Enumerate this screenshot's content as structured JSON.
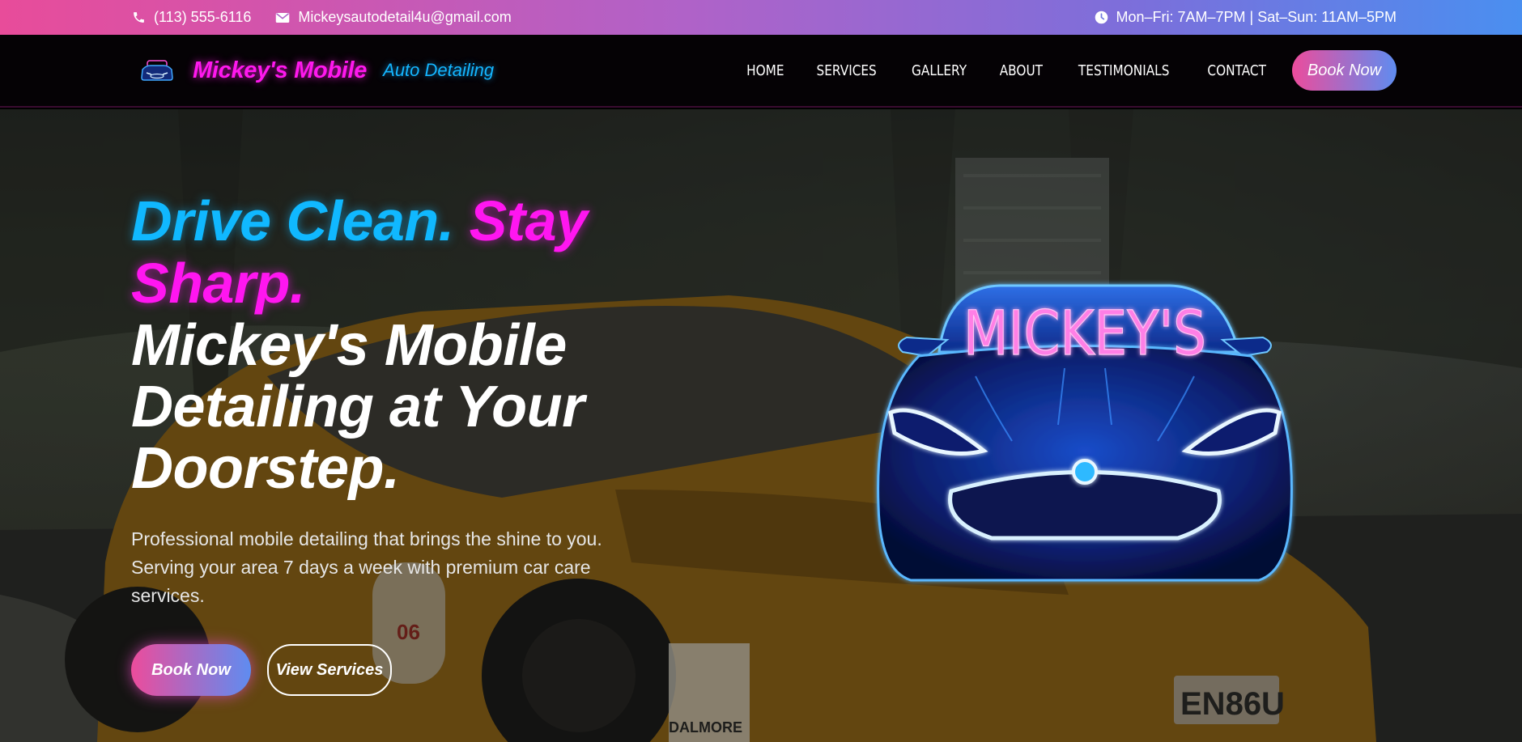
{
  "topbar": {
    "phone": "(113) 555-6116",
    "email": "Mickeysautodetail4u@gmail.com",
    "hours": "Mon–Fri: 7AM–7PM | Sat–Sun: 11AM–5PM",
    "icons": {
      "phone": "phone-icon",
      "email": "envelope-icon",
      "hours": "clock-icon"
    }
  },
  "navbar": {
    "brand_name": "Mickey's Mobile",
    "brand_sub": "Auto Detailing",
    "items": [
      {
        "label": "HOME"
      },
      {
        "label": "SERVICES"
      },
      {
        "label": "GALLERY"
      },
      {
        "label": "ABOUT"
      },
      {
        "label": "TESTIMONIALS"
      },
      {
        "label": "CONTACT"
      }
    ],
    "book_label": "Book Now"
  },
  "hero": {
    "tagline_part1": "Drive Clean.",
    "tagline_part2": "Stay Sharp.",
    "headline": "Mickey's Mobile Detailing at Your Doorstep.",
    "description": "Professional mobile detailing that brings the shine to you. Serving your area 7 days a week with premium car care services.",
    "book_label": "Book Now",
    "services_label": "View Services",
    "neon_logo_text": "MICKEY'S"
  },
  "colors": {
    "accent_pink": "#ff16f0",
    "accent_cyan": "#10b8ff",
    "gradient_start": "#e84c9a",
    "gradient_end": "#4a8ff0"
  }
}
